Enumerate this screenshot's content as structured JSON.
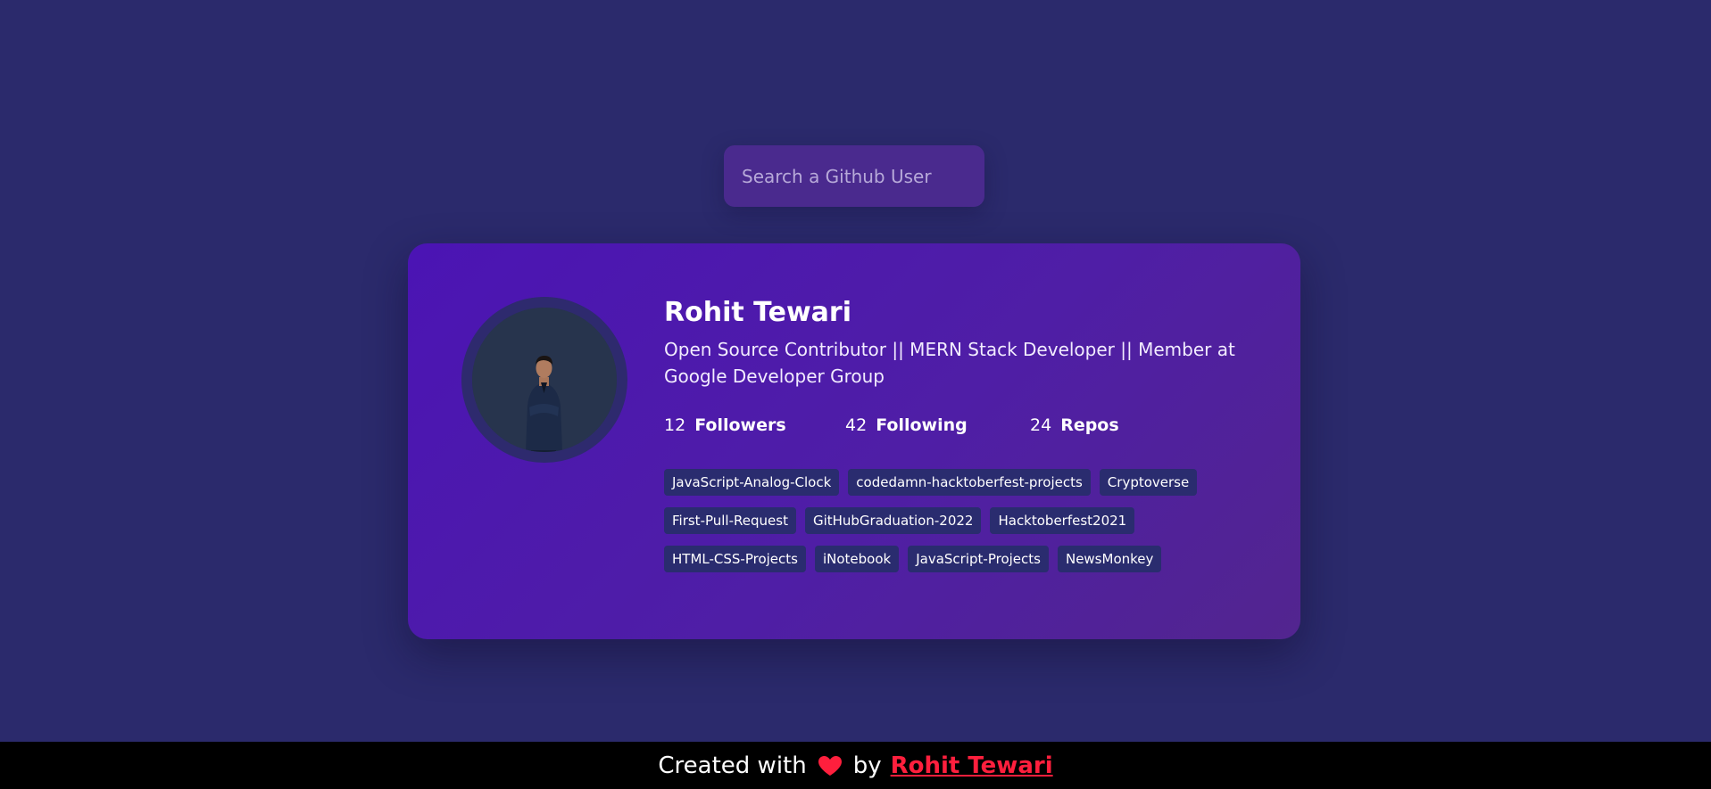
{
  "search": {
    "placeholder": "Search a Github User",
    "value": ""
  },
  "profile": {
    "name": "Rohit Tewari",
    "bio": "Open Source Contributor || MERN Stack Developer || Member at Google Developer Group",
    "stats": [
      {
        "value": "12",
        "label": "Followers"
      },
      {
        "value": "42",
        "label": "Following"
      },
      {
        "value": "24",
        "label": "Repos"
      }
    ],
    "repos": [
      "JavaScript-Analog-Clock",
      "codedamn-hacktoberfest-projects",
      "Cryptoverse",
      "First-Pull-Request",
      "GitHubGraduation-2022",
      "Hacktoberfest2021",
      "HTML-CSS-Projects",
      "iNotebook",
      "JavaScript-Projects",
      "NewsMonkey"
    ]
  },
  "footer": {
    "prefix": "Created with",
    "icon": "heart-icon",
    "middle": "by",
    "author": "Rohit Tewari"
  },
  "colors": {
    "background": "#2b2a6c",
    "card": "#4b14b4",
    "repo_badge": "#2a2c6f",
    "heart": "#ff1f3d",
    "author_link": "#ff1f3d"
  }
}
